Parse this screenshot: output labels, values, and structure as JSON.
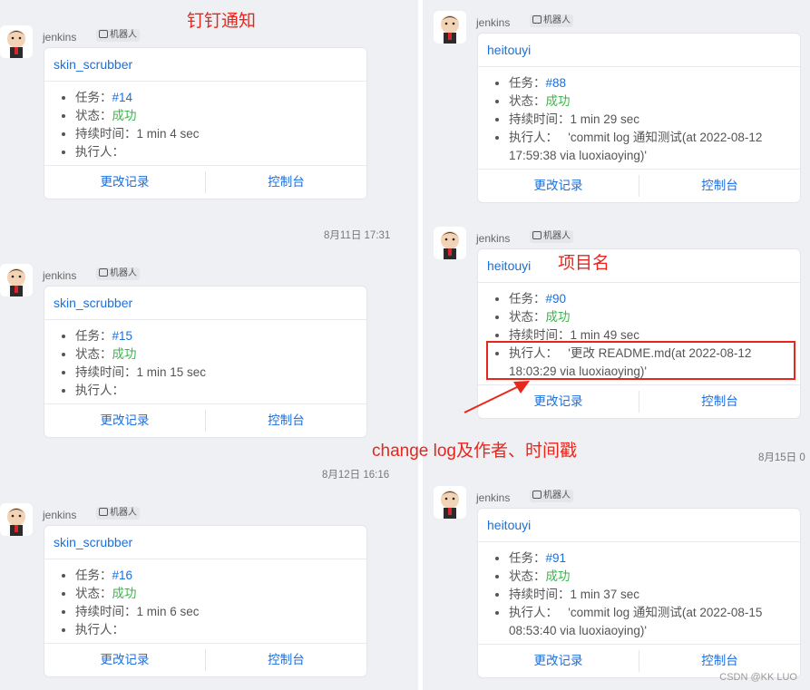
{
  "annotations": {
    "title": "钉钉通知",
    "project_name": "项目名",
    "changelog": "change log及作者、时间戳"
  },
  "colors": {
    "annotation": "#e8261c",
    "link": "#1a6fe0",
    "success": "#3ab54a"
  },
  "labels": {
    "sender": "jenkins",
    "robot_badge": "机器人",
    "task": "任务：",
    "status": "状态：",
    "duration": "持续时间：",
    "executor": "执行人：",
    "btn_changes": "更改记录",
    "btn_console": "控制台"
  },
  "left_messages": [
    {
      "title": "skin_scrubber",
      "task": "#14",
      "status": "成功",
      "duration": "1 min 4 sec",
      "executor": ""
    },
    {
      "title": "skin_scrubber",
      "task": "#15",
      "status": "成功",
      "duration": "1 min 15 sec",
      "executor": ""
    },
    {
      "title": "skin_scrubber",
      "task": "#16",
      "status": "成功",
      "duration": "1 min 6 sec",
      "executor": ""
    }
  ],
  "right_messages": [
    {
      "title": "heitouyi",
      "task": "#88",
      "status": "成功",
      "duration": "1 min 29 sec",
      "executor_line1": "'commit log 通知测试(at 2022-08-12",
      "executor_line2": "17:59:38 via luoxiaoying)'"
    },
    {
      "title": "heitouyi",
      "task": "#90",
      "status": "成功",
      "duration": "1 min 49 sec",
      "executor_line1": "'更改 README.md(at 2022-08-12",
      "executor_line2": "18:03:29 via luoxiaoying)'"
    },
    {
      "title": "heitouyi",
      "task": "#91",
      "status": "成功",
      "duration": "1 min 37 sec",
      "executor_line1": "'commit log 通知测试(at 2022-08-15",
      "executor_line2": "08:53:40 via luoxiaoying)'"
    }
  ],
  "timestamps": {
    "left_1": "8月11日 17:31",
    "left_2": "8月12日 16:16",
    "right_1": "8月15日 0"
  },
  "watermark": "CSDN @KK LUO"
}
